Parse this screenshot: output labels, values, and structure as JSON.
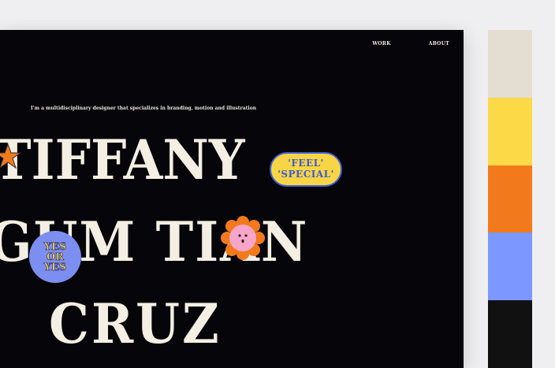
{
  "nav": {
    "items": [
      {
        "label": "WORK"
      },
      {
        "label": "ABOUT"
      }
    ]
  },
  "hero": {
    "tagline": "I'm a multidisciplinary designer that specializes in branding, motion and illustration",
    "name_lines": [
      "TIFFANY",
      "GUM TIAN",
      "CRUZ"
    ]
  },
  "stickers": {
    "feel": {
      "line1": "'FEEL'",
      "line2": "'SPECIAL'"
    },
    "yes_or_yes": {
      "line1": "YES",
      "line2": "OR",
      "line3": "YES"
    },
    "flower": {
      "icon": "smiley-flower-icon"
    },
    "star": {
      "icon": "orange-star-icon"
    }
  },
  "palette": {
    "colors": [
      "#e3ddd2",
      "#fbd947",
      "#f27a1c",
      "#7c97ff",
      "#111111"
    ]
  }
}
